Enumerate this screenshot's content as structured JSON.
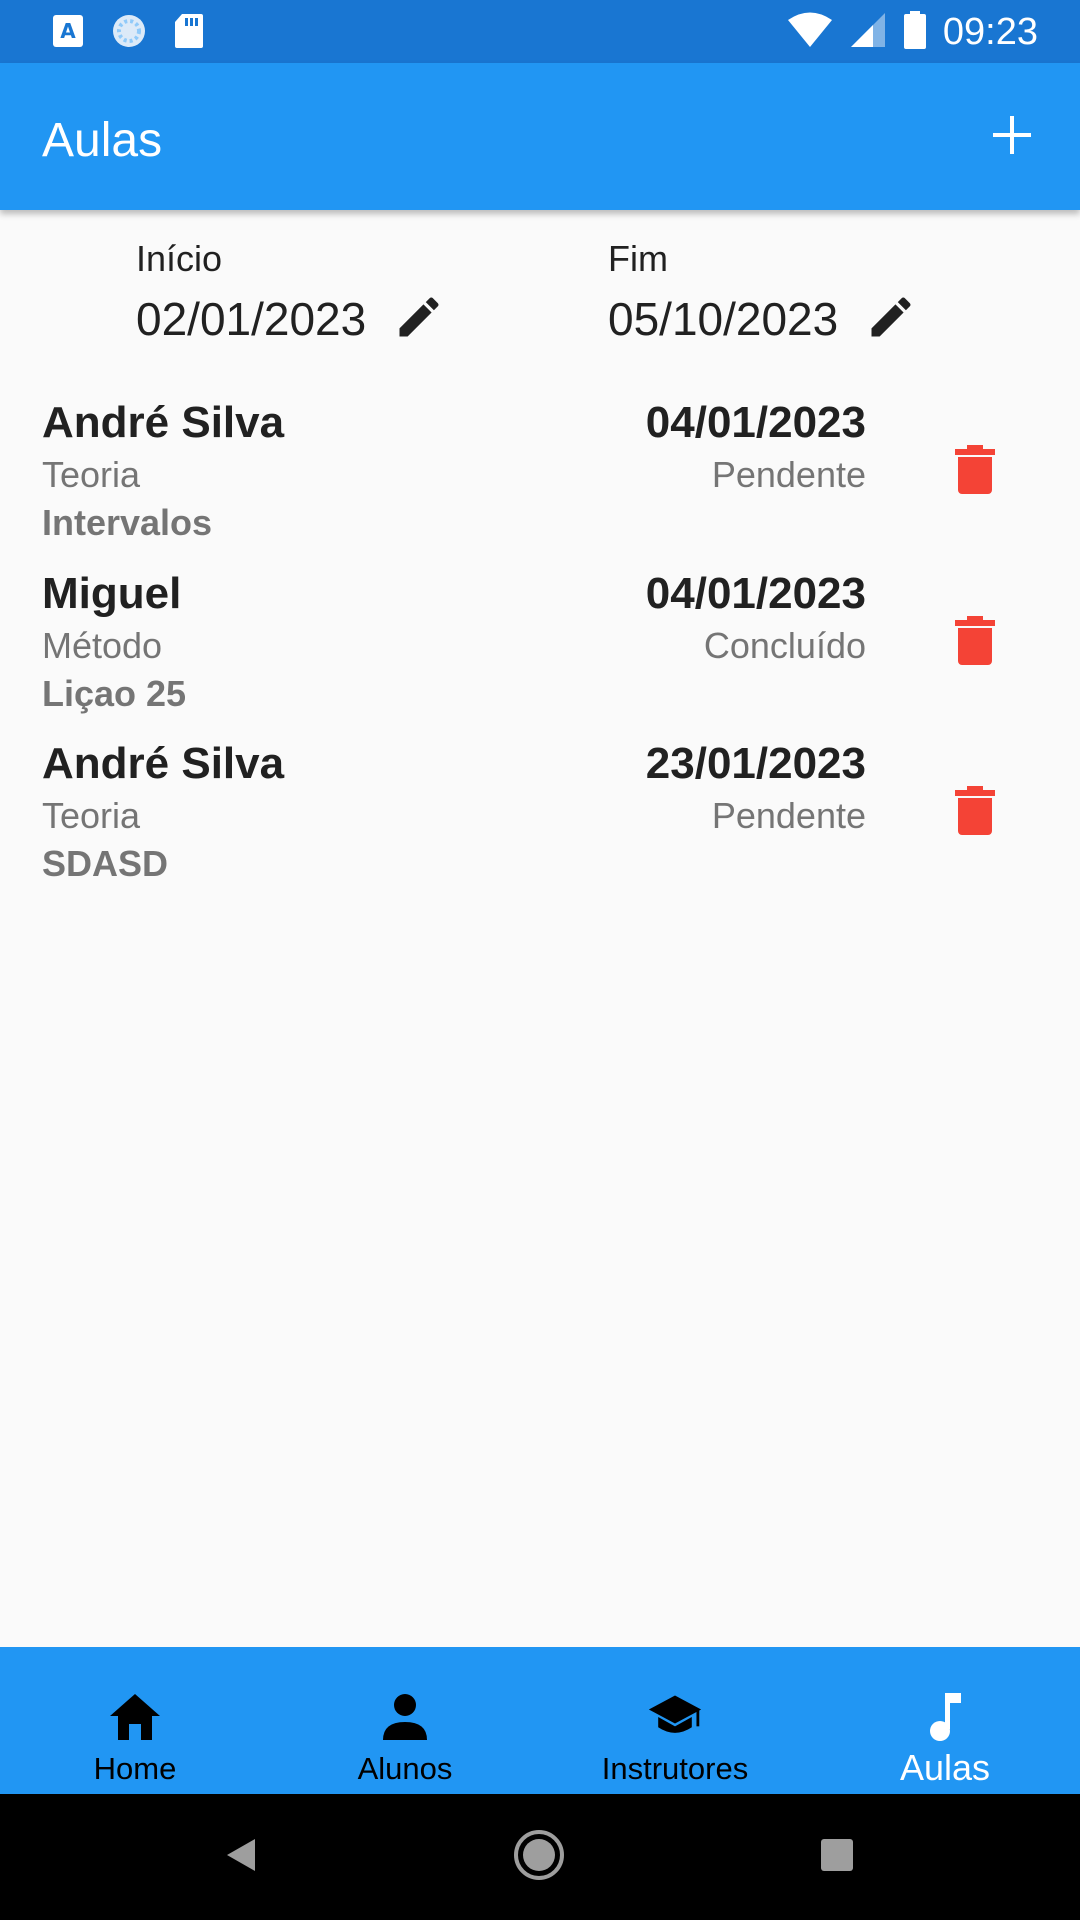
{
  "status_bar": {
    "time": "09:23",
    "left_icons": [
      "text-format-icon",
      "sync-icon",
      "sd-card-icon"
    ],
    "right_icons": [
      "wifi-icon",
      "signal-icon",
      "battery-icon"
    ]
  },
  "app_bar": {
    "title": "Aulas",
    "action_icon": "add-icon"
  },
  "filter": {
    "start_label": "Início",
    "start_value": "02/01/2023",
    "end_label": "Fim",
    "end_value": "05/10/2023"
  },
  "lessons": [
    {
      "name": "André Silva",
      "type": "Teoria",
      "topic": "Intervalos",
      "date": "04/01/2023",
      "status": "Pendente"
    },
    {
      "name": "Miguel",
      "type": "Método",
      "topic": "Liçao 25",
      "date": "04/01/2023",
      "status": "Concluído"
    },
    {
      "name": "André Silva",
      "type": "Teoria",
      "topic": "SDASD",
      "date": "23/01/2023",
      "status": "Pendente"
    }
  ],
  "bottom_nav": {
    "items": [
      {
        "label": "Home",
        "icon": "home-icon"
      },
      {
        "label": "Alunos",
        "icon": "person-icon"
      },
      {
        "label": "Instrutores",
        "icon": "school-icon"
      },
      {
        "label": "Aulas",
        "icon": "music-note-icon"
      }
    ],
    "active_index": 3
  },
  "colors": {
    "status_bar": "#1976D2",
    "primary": "#2196F3",
    "delete": "#F44336",
    "background": "#FAFAFA"
  }
}
